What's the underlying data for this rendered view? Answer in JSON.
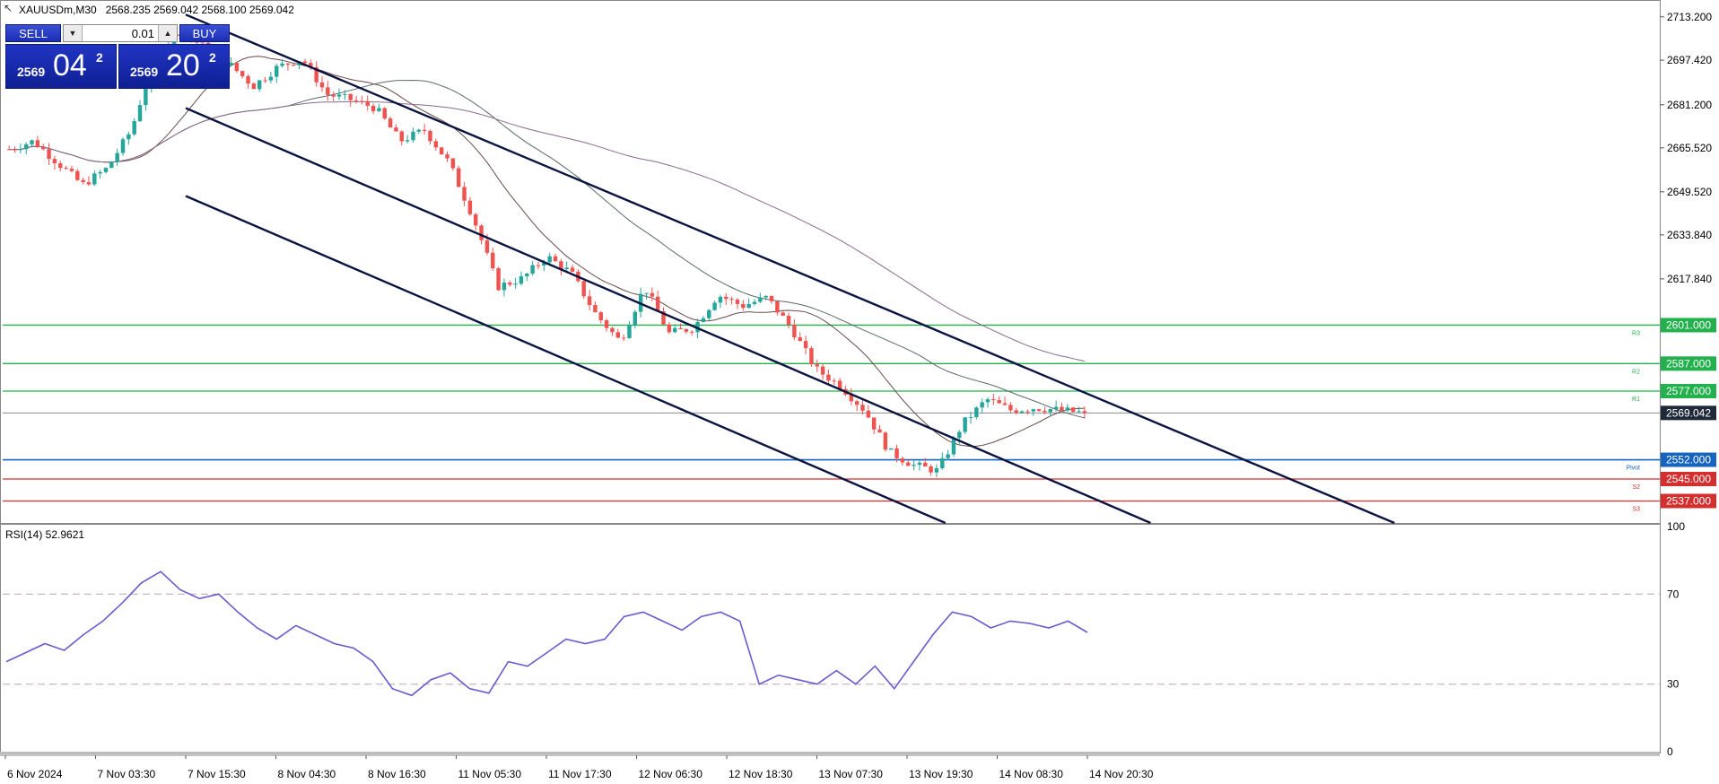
{
  "header": {
    "symbol": "XAUUSDm,M30",
    "ohlc": "2568.235 2569.042 2568.100 2569.042"
  },
  "trade_panel": {
    "sell_label": "SELL",
    "buy_label": "BUY",
    "lot_value": "0.01",
    "sell_price": {
      "prefix": "2569",
      "big": "04",
      "sup": "2"
    },
    "buy_price": {
      "prefix": "2569",
      "big": "20",
      "sup": "2"
    }
  },
  "icons": {
    "header_arrow": "cursor-arrow-icon",
    "lot_down": "triangle-down-icon",
    "lot_up": "triangle-up-icon"
  },
  "colors": {
    "candle_up": "#26a69a",
    "candle_down": "#ef5350",
    "channel": "#0b1340",
    "resistance": "#22b14c",
    "support": "#d32f2f",
    "pivot": "#1565c0",
    "rsi": "#6a5acd",
    "price_tag": "#1e2a38"
  },
  "chart_data": [
    {
      "type": "candlestick",
      "ylim": [
        2529.0,
        2719.0
      ],
      "ytick_labels": [
        "2713.200",
        "2697.420",
        "2681.200",
        "2665.520",
        "2649.520",
        "2633.840",
        "2617.840"
      ],
      "ytick_values": [
        2713.2,
        2697.42,
        2681.2,
        2665.52,
        2649.52,
        2633.84,
        2617.84
      ],
      "xtick_labels": [
        "6 Nov 2024",
        "7 Nov 03:30",
        "7 Nov 15:30",
        "8 Nov 04:30",
        "8 Nov 16:30",
        "11 Nov 05:30",
        "11 Nov 17:30",
        "12 Nov 06:30",
        "12 Nov 18:30",
        "13 Nov 07:30",
        "13 Nov 19:30",
        "14 Nov 08:30",
        "14 Nov 20:30"
      ],
      "close_path": [
        2665,
        2668,
        2660,
        2652,
        2658,
        2672,
        2700,
        2708,
        2702,
        2696,
        2688,
        2695,
        2698,
        2685,
        2683,
        2680,
        2668,
        2672,
        2660,
        2640,
        2615,
        2618,
        2626,
        2620,
        2605,
        2595,
        2615,
        2598,
        2600,
        2612,
        2608,
        2611,
        2600,
        2585,
        2579,
        2570,
        2555,
        2550,
        2548,
        2565,
        2574,
        2570,
        2571,
        2570,
        2569.042
      ],
      "levels": [
        {
          "label": "2601.000",
          "value": 2601.0,
          "tag": "R3",
          "kind": "resistance"
        },
        {
          "label": "2587.000",
          "value": 2587.0,
          "tag": "R2",
          "kind": "resistance"
        },
        {
          "label": "2577.000",
          "value": 2577.0,
          "tag": "R1",
          "kind": "resistance"
        },
        {
          "label": "2552.000",
          "value": 2552.0,
          "tag": "Pivot",
          "kind": "pivot"
        },
        {
          "label": "2545.000",
          "value": 2545.0,
          "tag": "S2",
          "kind": "support"
        },
        {
          "label": "2537.000",
          "value": 2537.0,
          "tag": "S3",
          "kind": "support"
        }
      ],
      "current_price": {
        "label": "2569.042",
        "value": 2569.042
      },
      "channel_lines": [
        {
          "start": {
            "x_label": "7 Nov 15:30",
            "y": 2714
          },
          "end": {
            "x_label": "14 Nov 20:30",
            "y": 2576
          }
        },
        {
          "start": {
            "x_label": "7 Nov 15:30",
            "y": 2680
          },
          "end": {
            "x_label": "14 Nov 08:30",
            "y": 2553
          }
        },
        {
          "start": {
            "x_label": "7 Nov 15:30",
            "y": 2648
          },
          "end": {
            "x_label": "13 Nov 19:30",
            "y": 2535
          }
        }
      ]
    },
    {
      "type": "line",
      "title": "RSI(14) 52.9621",
      "ylim": [
        0,
        100
      ],
      "ytick_labels": [
        "100",
        "70",
        "30",
        "0"
      ],
      "ytick_values": [
        100,
        70,
        30,
        0
      ],
      "levels": [
        70,
        30
      ],
      "series": [
        {
          "name": "RSI(14)",
          "values": [
            40,
            44,
            48,
            45,
            52,
            58,
            66,
            75,
            80,
            72,
            68,
            70,
            62,
            55,
            50,
            56,
            52,
            48,
            46,
            40,
            28,
            25,
            32,
            35,
            28,
            26,
            40,
            38,
            44,
            50,
            48,
            50,
            60,
            62,
            58,
            54,
            60,
            62,
            58,
            30,
            34,
            32,
            30,
            36,
            30,
            38,
            28,
            40,
            52,
            62,
            60,
            55,
            58,
            57,
            55,
            58,
            53
          ]
        }
      ]
    }
  ]
}
